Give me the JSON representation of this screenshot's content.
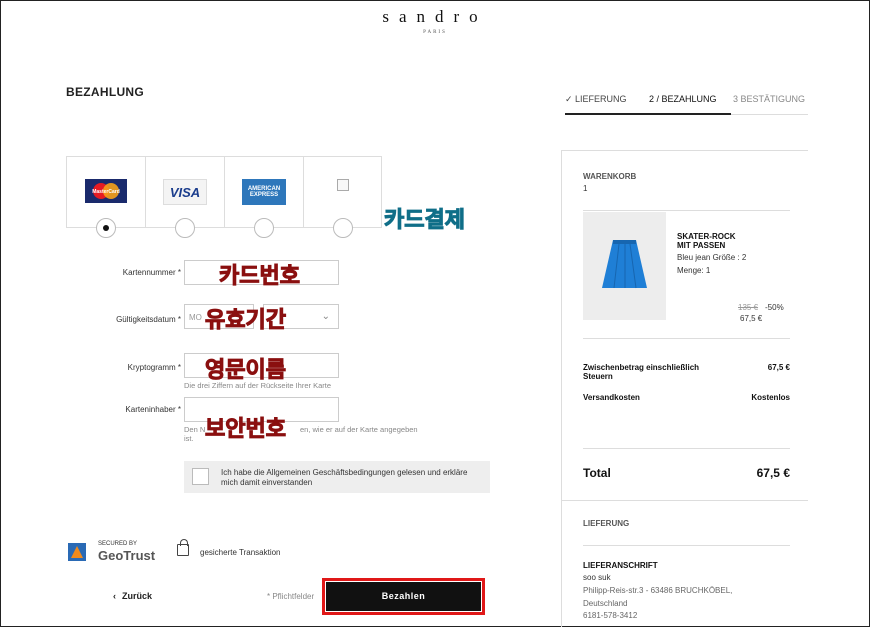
{
  "brand": {
    "name": "sandro",
    "sub": "PARIS"
  },
  "page_title": "BEZAHLUNG",
  "steps": [
    {
      "label": "✓  LIEFERUNG"
    },
    {
      "label": "2 / BEZAHLUNG"
    },
    {
      "label": "3 BESTÄTIGUNG"
    }
  ],
  "cards": [
    {
      "name": "MasterCard",
      "selected": true
    },
    {
      "name": "VISA",
      "selected": false
    },
    {
      "name": "AMERICAN EXPRESS",
      "selected": false
    },
    {
      "name": "",
      "selected": false
    }
  ],
  "overlays": {
    "card_payment": "카드결제",
    "card_number": "카드번호",
    "expiry": "유효기간",
    "english_name": "영문이름",
    "security_code": "보안번호"
  },
  "form": {
    "card_number_label": "Kartennummer *",
    "expiry_label": "Gültigkeitsdatum *",
    "expiry_month_placeholder": "MO",
    "crypto_label": "Kryptogramm *",
    "crypto_hint": "Die drei Ziffern auf der Rückseite Ihrer Karte",
    "holder_label": "Karteninhaber *",
    "holder_hint_start": "Den N",
    "holder_hint_end": "en, wie er auf der Karte angegeben",
    "holder_hint_tail": "ist."
  },
  "terms": {
    "text": "Ich habe die Allgemeinen Geschäftsbedingungen gelesen und erkläre mich damit einverstanden"
  },
  "security": {
    "secured_by": "SECURED BY",
    "geotrust": "GeoTrust",
    "transaction": "gesicherte Transaktion"
  },
  "actions": {
    "back": "Zurück",
    "required": "* Pflichtfelder",
    "pay": "Bezahlen"
  },
  "cart": {
    "title": "WARENKORB",
    "count": "1",
    "product_name_1": "SKATER-ROCK",
    "product_name_2": "MIT PASSEN",
    "variant": "Bleu jean Größe : 2",
    "quantity": "Menge: 1",
    "old_price": "135 €",
    "discount": "-50%",
    "new_price": "67,5 €",
    "subtotal_label_1": "Zwischenbetrag einschließlich",
    "subtotal_label_2": "Steuern",
    "subtotal_value": "67,5 €",
    "shipping_label": "Versandkosten",
    "shipping_value": "Kostenlos",
    "total_label": "Total",
    "total_value": "67,5 €"
  },
  "delivery": {
    "title": "LIEFERUNG",
    "address_title": "LIEFERANSCHRIFT",
    "name": "soo suk",
    "street": "Philipp-Reis-str.3 - 63486 BRUCHKÖBEL,",
    "country": "Deutschland",
    "phone": "6181-578-3412"
  },
  "colors": {
    "accent": "#111111",
    "highlight_border": "#e01818",
    "overlay_red": "#e03030",
    "overlay_blue": "#2bb5d8",
    "skirt": "#1f7fd6"
  }
}
